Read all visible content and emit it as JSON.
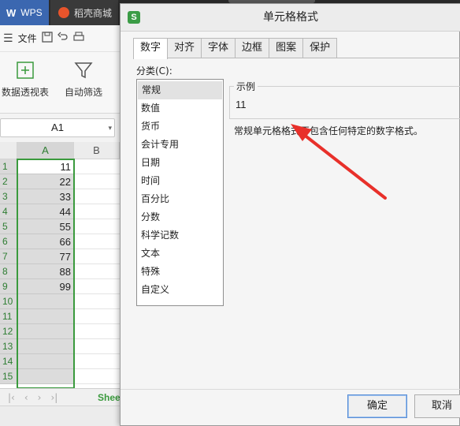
{
  "titlebar": {
    "wps_tab_label": "WPS",
    "store_tab_label": "稻壳商城"
  },
  "menubar": {
    "file_label": "文件"
  },
  "ribbon": {
    "pivot_label": "数据透视表",
    "autofilter_label": "自动筛选"
  },
  "namebox": {
    "value": "A1"
  },
  "grid": {
    "col_a": "A",
    "col_b": "B",
    "rows": [
      {
        "n": "1",
        "v": "11"
      },
      {
        "n": "2",
        "v": "22"
      },
      {
        "n": "3",
        "v": "33"
      },
      {
        "n": "4",
        "v": "44"
      },
      {
        "n": "5",
        "v": "55"
      },
      {
        "n": "6",
        "v": "66"
      },
      {
        "n": "7",
        "v": "77"
      },
      {
        "n": "8",
        "v": "88"
      },
      {
        "n": "9",
        "v": "99"
      },
      {
        "n": "10",
        "v": ""
      },
      {
        "n": "11",
        "v": ""
      },
      {
        "n": "12",
        "v": ""
      },
      {
        "n": "13",
        "v": ""
      },
      {
        "n": "14",
        "v": ""
      },
      {
        "n": "15",
        "v": ""
      }
    ],
    "sheet_tab": "Shee"
  },
  "dialog": {
    "title": "单元格格式",
    "app_icon": "S",
    "tabs": [
      "数字",
      "对齐",
      "字体",
      "边框",
      "图案",
      "保护"
    ],
    "category_label": "分类(C):",
    "categories": [
      "常规",
      "数值",
      "货币",
      "会计专用",
      "日期",
      "时间",
      "百分比",
      "分数",
      "科学记数",
      "文本",
      "特殊",
      "自定义"
    ],
    "example_legend": "示例",
    "example_value": "11",
    "description": "常规单元格格式不包含任何特定的数字格式。",
    "ok_label": "确定",
    "cancel_label": "取消"
  },
  "colors": {
    "accent_green": "#3a9a3d",
    "wps_blue": "#3b67b0",
    "arrow_red": "#e8302a"
  }
}
